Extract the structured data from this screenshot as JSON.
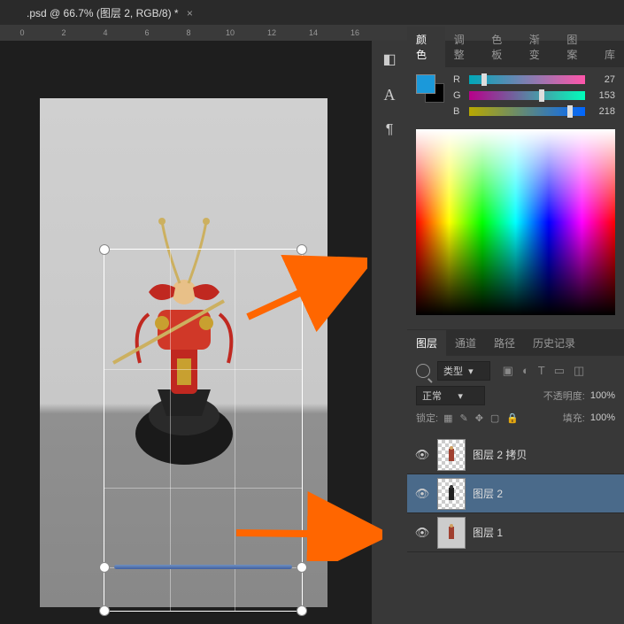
{
  "document": {
    "tab_title": ".psd @ 66.7% (图层 2, RGB/8) *"
  },
  "ruler": {
    "marks": [
      "0",
      "2",
      "4",
      "6",
      "8",
      "10",
      "12",
      "14",
      "16"
    ]
  },
  "color_panel": {
    "tabs": [
      "颜色",
      "调整",
      "色板",
      "渐变",
      "图案",
      "库"
    ],
    "active_tab": 0,
    "channels": {
      "r": {
        "label": "R",
        "value": "27",
        "pos": 11
      },
      "g": {
        "label": "G",
        "value": "153",
        "pos": 60
      },
      "b": {
        "label": "B",
        "value": "218",
        "pos": 85
      }
    },
    "foreground": "#1b99da"
  },
  "layers_panel": {
    "tabs": [
      "图层",
      "通道",
      "路径",
      "历史记录"
    ],
    "active_tab": 0,
    "filter_label": "类型",
    "blend_mode": "正常",
    "opacity_label": "不透明度:",
    "opacity_value": "100%",
    "lock_label": "锁定:",
    "fill_label": "填充:",
    "fill_value": "100%",
    "layers": [
      {
        "name": "图层 2 拷贝",
        "visible": true,
        "selected": false,
        "checker": true
      },
      {
        "name": "图层 2",
        "visible": true,
        "selected": true,
        "checker": true
      },
      {
        "name": "图层 1",
        "visible": true,
        "selected": false,
        "checker": false
      }
    ]
  }
}
